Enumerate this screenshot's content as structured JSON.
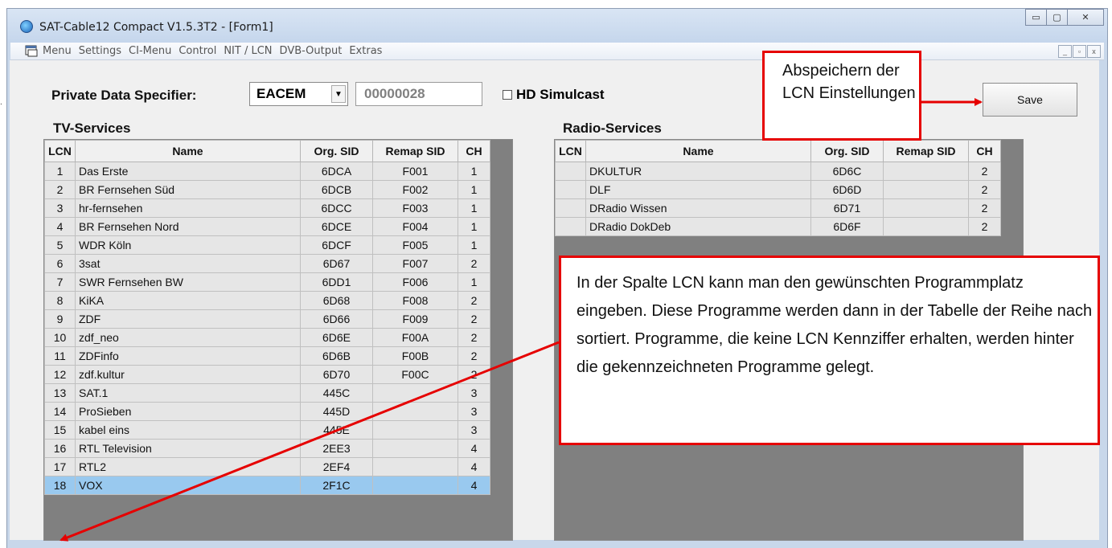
{
  "window": {
    "title": "SAT-Cable12 Compact V1.5.3T2 - [Form1]",
    "controls": {
      "minimize": "▭",
      "maximize": "▢",
      "close": "✕"
    }
  },
  "menubar": {
    "items": [
      "Menu",
      "Settings",
      "CI-Menu",
      "Control",
      "NIT / LCN",
      "DVB-Output",
      "Extras"
    ],
    "mdi": {
      "minimize": "_",
      "restore": "▫",
      "close": "x"
    }
  },
  "pds": {
    "label": "Private Data Specifier:",
    "selected": "EACEM",
    "value": "00000028",
    "hd_simulcast_label": "HD Simulcast",
    "hd_simulcast_checked": false
  },
  "save_button": {
    "label": "Save"
  },
  "tv": {
    "title": "TV-Services",
    "columns": [
      "LCN",
      "Name",
      "Org. SID",
      "Remap SID",
      "CH"
    ],
    "rows": [
      [
        "1",
        "Das Erste",
        "6DCA",
        "F001",
        "1"
      ],
      [
        "2",
        "BR Fernsehen Süd",
        "6DCB",
        "F002",
        "1"
      ],
      [
        "3",
        "hr-fernsehen",
        "6DCC",
        "F003",
        "1"
      ],
      [
        "4",
        "BR Fernsehen Nord",
        "6DCE",
        "F004",
        "1"
      ],
      [
        "5",
        "WDR Köln",
        "6DCF",
        "F005",
        "1"
      ],
      [
        "6",
        "3sat",
        "6D67",
        "F007",
        "2"
      ],
      [
        "7",
        "SWR Fernsehen BW",
        "6DD1",
        "F006",
        "1"
      ],
      [
        "8",
        "KiKA",
        "6D68",
        "F008",
        "2"
      ],
      [
        "9",
        "ZDF",
        "6D66",
        "F009",
        "2"
      ],
      [
        "10",
        "zdf_neo",
        "6D6E",
        "F00A",
        "2"
      ],
      [
        "11",
        "ZDFinfo",
        "6D6B",
        "F00B",
        "2"
      ],
      [
        "12",
        "zdf.kultur",
        "6D70",
        "F00C",
        "2"
      ],
      [
        "13",
        "SAT.1",
        "445C",
        "",
        "3"
      ],
      [
        "14",
        "ProSieben",
        "445D",
        "",
        "3"
      ],
      [
        "15",
        "kabel eins",
        "445E",
        "",
        "3"
      ],
      [
        "16",
        "RTL Television",
        "2EE3",
        "",
        "4"
      ],
      [
        "17",
        "RTL2",
        "2EF4",
        "",
        "4"
      ],
      [
        "18",
        "VOX",
        "2F1C",
        "",
        "4"
      ]
    ],
    "selected_row": 17
  },
  "radio": {
    "title": "Radio-Services",
    "columns": [
      "LCN",
      "Name",
      "Org. SID",
      "Remap SID",
      "CH"
    ],
    "rows": [
      [
        "",
        "DKULTUR",
        "6D6C",
        "",
        "2"
      ],
      [
        "",
        "DLF",
        "6D6D",
        "",
        "2"
      ],
      [
        "",
        "DRadio Wissen",
        "6D71",
        "",
        "2"
      ],
      [
        "",
        "DRadio DokDeb",
        "6D6F",
        "",
        "2"
      ]
    ]
  },
  "callouts": {
    "save": "Abspeichern der LCN Einstellungen",
    "lcn": "In der Spalte LCN kann man den gewünschten Programmplatz eingeben. Diese Programme werden dann in der Tabelle der Reihe nach sortiert. Programme, die keine LCN Kennziffer erhalten, werden hinter die gekennzeichneten Programme gelegt."
  },
  "colors": {
    "callout_border": "#e60000",
    "selected_row": "#99c9ef",
    "grid_background": "#808080"
  }
}
